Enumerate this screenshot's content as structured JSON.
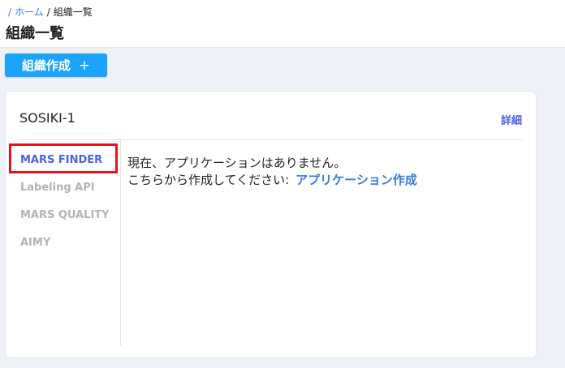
{
  "breadcrumb": {
    "sep": "/",
    "home": "ホーム",
    "current": "組織一覧"
  },
  "page_title": "組織一覧",
  "create_button": {
    "label": "組織作成",
    "plus": "+"
  },
  "org_card": {
    "title": "SOSIKI-1",
    "detail_link": "詳細",
    "apps": [
      {
        "label": "MARS FINDER",
        "active": true
      },
      {
        "label": "Labeling API",
        "active": false
      },
      {
        "label": "MARS QUALITY",
        "active": false
      },
      {
        "label": "AIMY",
        "active": false
      }
    ],
    "message_line1": "現在、アプリケーションはありません。",
    "message_line2": "こちらから作成してください:",
    "create_app_link": "アプリケーション作成"
  },
  "colors": {
    "accent": "#1aa3ff",
    "link": "#3a7bd5",
    "active_item": "#4d63d8",
    "highlight": "#e4131e"
  }
}
